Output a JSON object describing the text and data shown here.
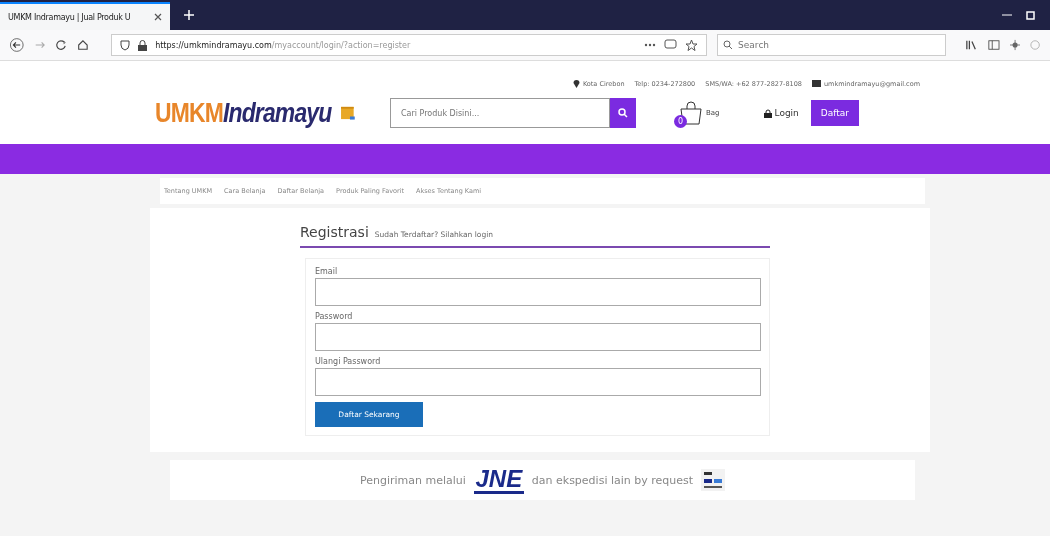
{
  "browser": {
    "tab_title": "UMKM Indramayu | Jual Produk U",
    "url_domain": "https://umkmindramayu.com",
    "url_path": "/myaccount/login/?action=register",
    "search_placeholder": "Search"
  },
  "contact": [
    {
      "kind": "location",
      "text": "Kota Cirebon"
    },
    {
      "kind": "plain",
      "text": "Telp: 0234-272800"
    },
    {
      "kind": "plain",
      "text": "SMS/WA: +62 877-2827-8108"
    },
    {
      "kind": "mail",
      "text": "umkmindramayu@gmail.com"
    }
  ],
  "logo": {
    "part_1": "UMKM",
    "part_2": "Indramayu"
  },
  "search": {
    "placeholder": "Cari Produk Disini..."
  },
  "cart": {
    "count": "0",
    "label": "Bag"
  },
  "login": "Login",
  "register": "Daftar",
  "nav": [
    "Tentang UMKM",
    "Cara Belanja",
    "Daftar Belanja",
    "Produk Paling Favorit",
    "Akses Tentang Kami"
  ],
  "form": {
    "title": "Registrasi",
    "subtitle": "Sudah Terdaftar? Silahkan login",
    "fields": [
      {
        "label": "Email"
      },
      {
        "label": "Password"
      },
      {
        "label": "Ulangi Password"
      }
    ],
    "submit": "Daftar Sekarang"
  },
  "footer": {
    "before": "Pengiriman melalui",
    "logo": "JNE",
    "after": "dan ekspedisi lain by request"
  }
}
